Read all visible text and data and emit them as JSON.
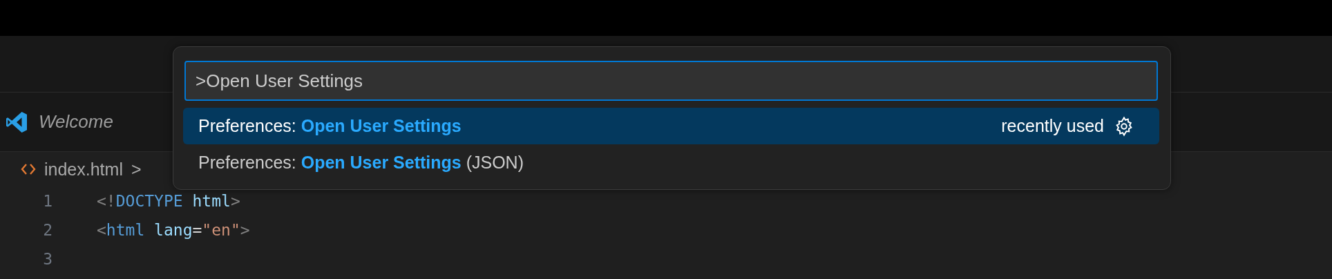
{
  "tab": {
    "label": "Welcome",
    "italic": true
  },
  "breadcrumb": {
    "file": "index.html",
    "separator": ">"
  },
  "editor": {
    "lines": [
      {
        "number": "1",
        "tokens": [
          {
            "text": "<!",
            "kind": "punct"
          },
          {
            "text": "DOCTYPE",
            "kind": "keyword"
          },
          {
            "text": " html",
            "kind": "attr"
          },
          {
            "text": ">",
            "kind": "punct"
          }
        ]
      },
      {
        "number": "2",
        "tokens": [
          {
            "text": "<",
            "kind": "punct"
          },
          {
            "text": "html",
            "kind": "keyword"
          },
          {
            "text": " lang",
            "kind": "attr"
          },
          {
            "text": "=",
            "kind": "plain"
          },
          {
            "text": "\"en\"",
            "kind": "string"
          },
          {
            "text": ">",
            "kind": "punct"
          }
        ]
      },
      {
        "number": "3"
      }
    ]
  },
  "command_palette": {
    "value": ">Open User Settings",
    "items": [
      {
        "prefix": "Preferences: ",
        "match": "Open User Settings",
        "detail": "recently used",
        "selected": true
      },
      {
        "prefix": "Preferences: ",
        "match": "Open User Settings",
        "suffix": " (JSON)",
        "selected": false
      }
    ]
  }
}
